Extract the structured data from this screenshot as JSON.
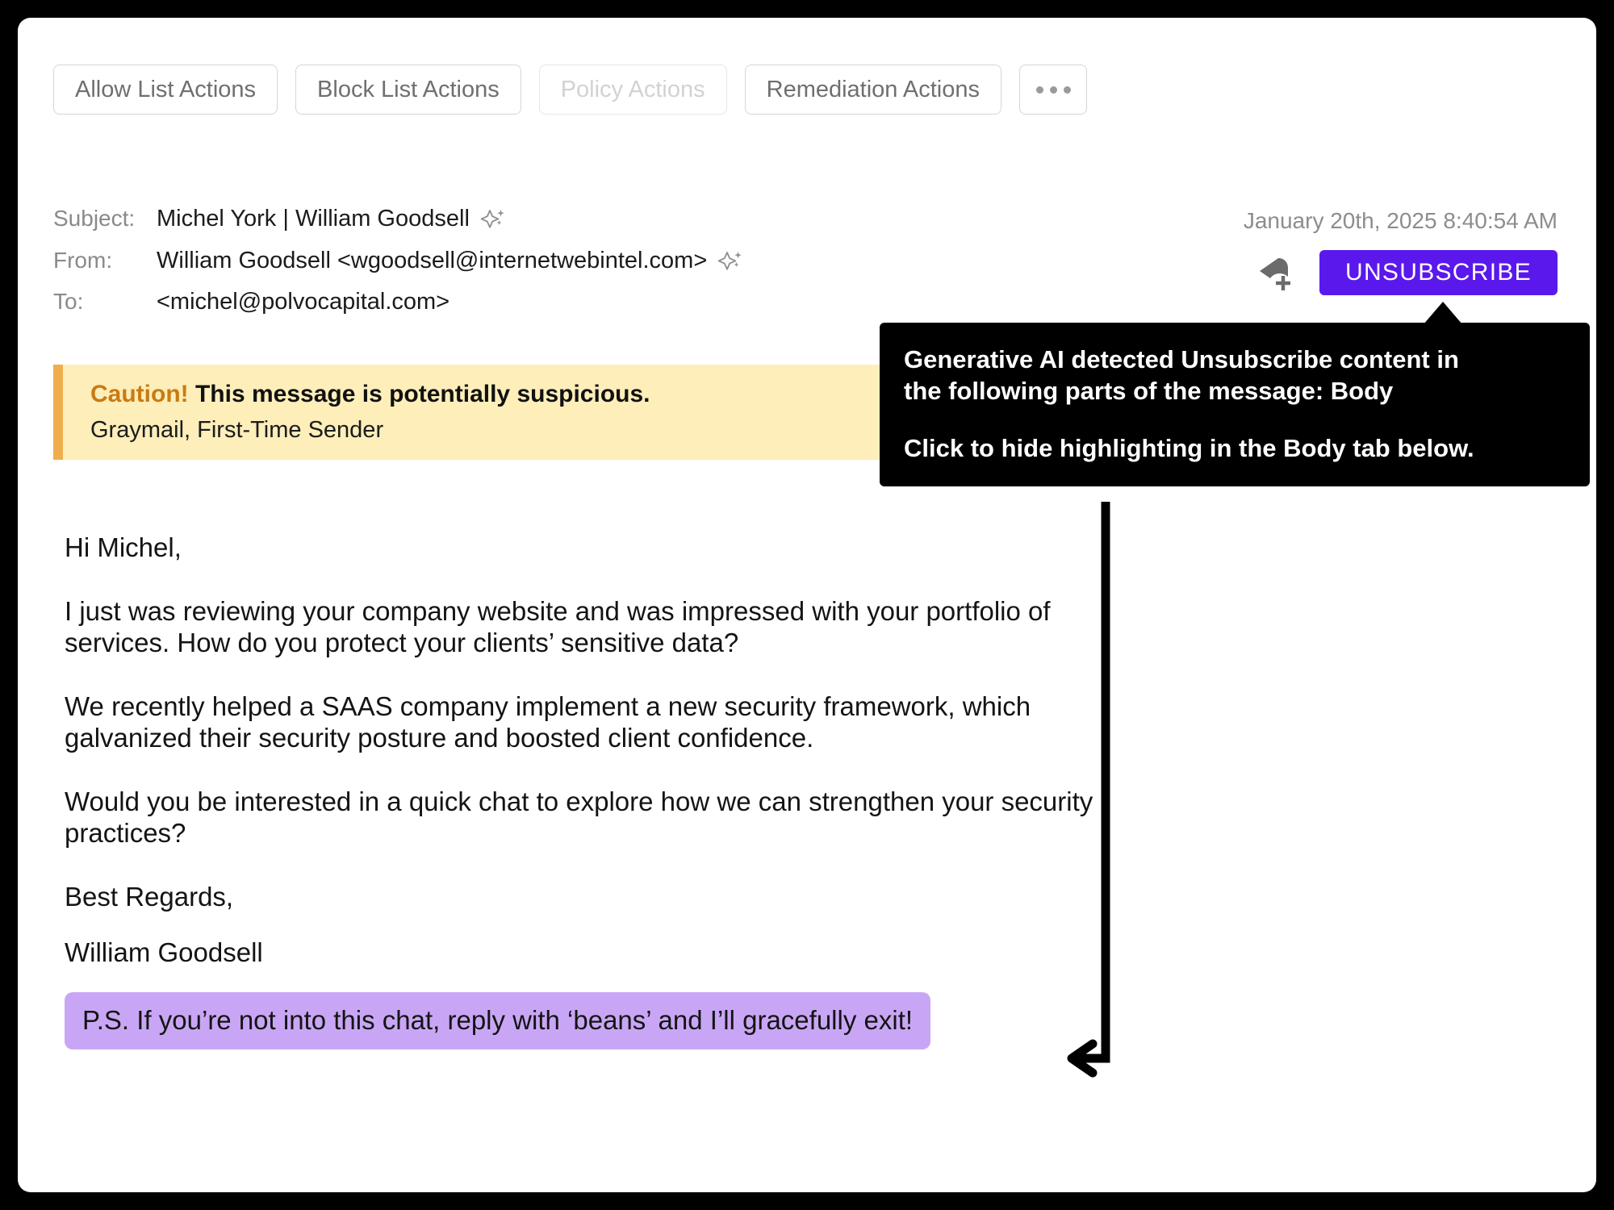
{
  "toolbar": {
    "buttons": [
      {
        "label": "Allow List Actions",
        "disabled": false
      },
      {
        "label": "Block List Actions",
        "disabled": false
      },
      {
        "label": "Policy Actions",
        "disabled": true
      },
      {
        "label": "Remediation Actions",
        "disabled": false
      }
    ],
    "more_label": "..."
  },
  "headers": {
    "subject_label": "Subject:",
    "subject_value": "Michel York | William Goodsell",
    "from_label": "From:",
    "from_value": "William Goodsell <wgoodsell@internetwebintel.com>",
    "to_label": "To:",
    "to_value": "<michel@polvocapital.com>",
    "date": "January 20th, 2025 8:40:54 AM"
  },
  "actions": {
    "unsubscribe_label": "UNSUBSCRIBE",
    "unsubscribe_color": "#5b18ec",
    "tag_icon_color": "#6b6b6b"
  },
  "caution": {
    "prefix": "Caution!",
    "headline": "This message is potentially suspicious.",
    "detail": "Graymail, First-Time Sender",
    "accent_color": "#f0ad4e",
    "background_color": "#fdeeba",
    "prefix_color": "#c97b12"
  },
  "message_body": {
    "greeting": "Hi Michel,",
    "paragraph_1": "I just was reviewing your company website and was impressed with your portfolio of services. How do you protect your clients’ sensitive data?",
    "paragraph_2": "We recently helped a SAAS company implement a new security framework, which galvanized their security posture and boosted client confidence.",
    "paragraph_3": "Would you be interested in a quick chat to explore how we can strengthen your security practices?",
    "signoff": "Best Regards,",
    "signature": "William Goodsell",
    "ps_highlighted": "P.S. If you’re not into this chat, reply with ‘beans’ and I’ll gracefully exit!",
    "highlight_color": "#c9a6f5"
  },
  "tooltip": {
    "line_1": "Generative AI detected Unsubscribe content in",
    "line_2": "the following parts of the message: Body",
    "line_3": "Click to hide highlighting in the Body tab below.",
    "background_color": "#000000",
    "text_color": "#ffffff"
  }
}
